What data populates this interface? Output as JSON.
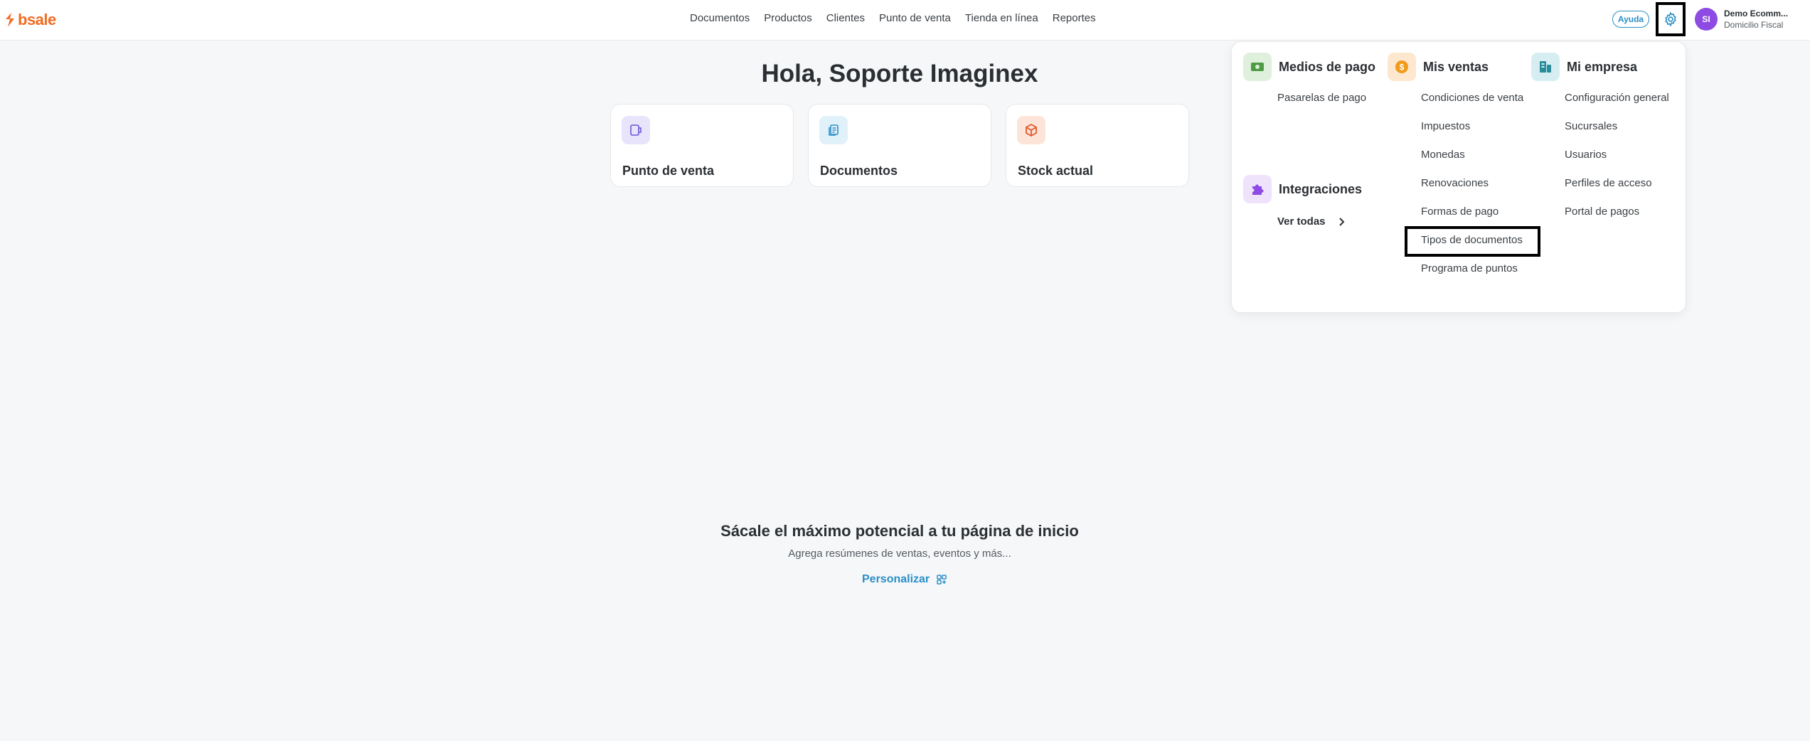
{
  "header": {
    "logo_text": "bsale",
    "nav": [
      "Documentos",
      "Productos",
      "Clientes",
      "Punto de venta",
      "Tienda en línea",
      "Reportes"
    ],
    "help_label": "Ayuda",
    "avatar_initials": "SI",
    "company_name": "Demo Ecomm...",
    "company_sub": "Domicilio Fiscal"
  },
  "main": {
    "greeting": "Hola, Soporte Imaginex",
    "cards": [
      {
        "label": "Punto de venta",
        "icon": "pos-icon"
      },
      {
        "label": "Documentos",
        "icon": "documents-icon"
      },
      {
        "label": "Stock actual",
        "icon": "box-icon"
      }
    ]
  },
  "settings_menu": {
    "medios_de_pago": {
      "title": "Medios de pago",
      "items": [
        "Pasarelas de pago"
      ]
    },
    "integraciones": {
      "title": "Integraciones",
      "link": "Ver todas"
    },
    "mis_ventas": {
      "title": "Mis ventas",
      "items": [
        "Condiciones de venta",
        "Impuestos",
        "Monedas",
        "Renovaciones",
        "Formas de pago",
        "Tipos de documentos",
        "Programa de puntos"
      ]
    },
    "mi_empresa": {
      "title": "Mi empresa",
      "items": [
        "Configuración general",
        "Sucursales",
        "Usuarios",
        "Perfiles de acceso",
        "Portal de pagos"
      ]
    }
  },
  "promo": {
    "title": "Sácale el máximo potencial a tu página de inicio",
    "subtitle": "Agrega resúmenes de ventas, eventos y más...",
    "action": "Personalizar"
  },
  "colors": {
    "brand": "#f26b21",
    "link_blue": "#2a8fc7",
    "avatar": "#8d4be3"
  }
}
